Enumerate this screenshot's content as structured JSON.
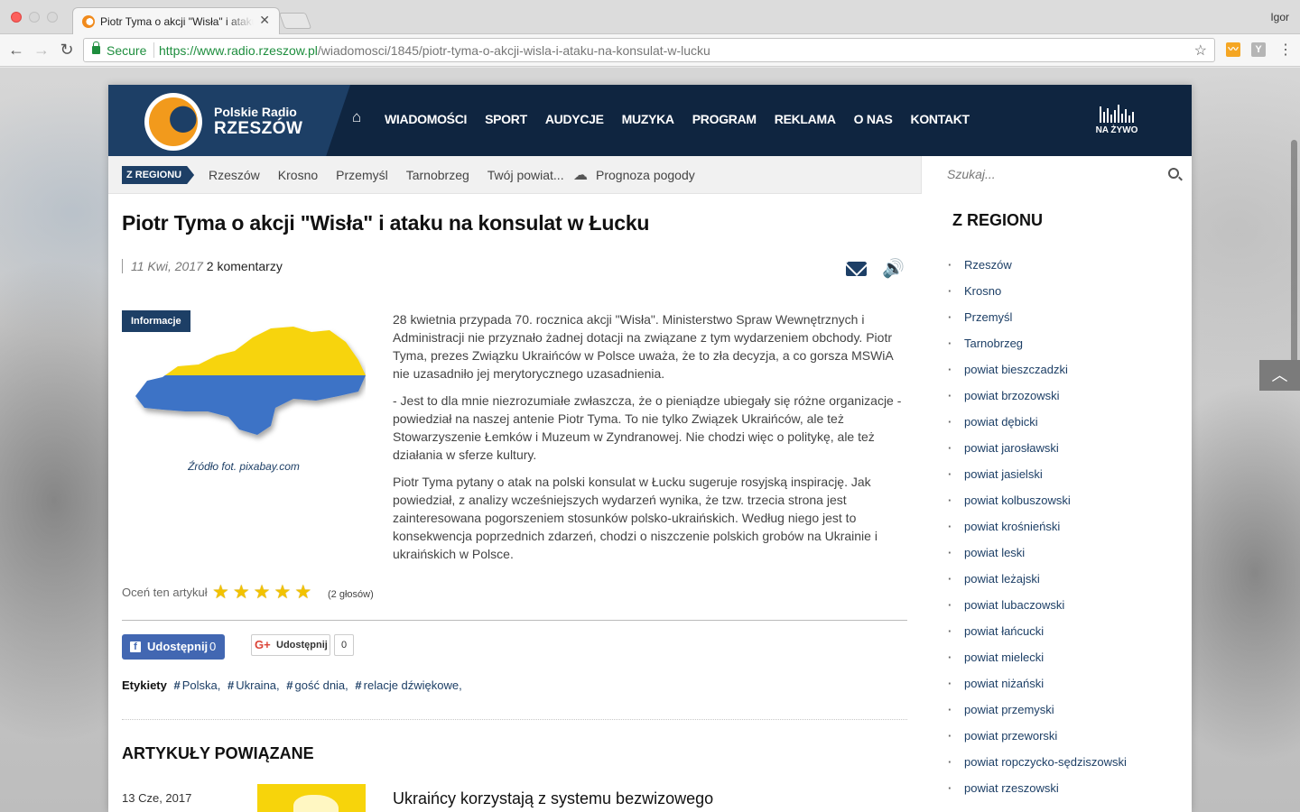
{
  "browser": {
    "tab_title": "Piotr Tyma o akcji \"Wisła\" i ataku na konsulat w Łucku",
    "tab_close": "✕",
    "user": "Igor",
    "secure_label": "Secure",
    "url_scheme_host": "https://www.radio.rzeszow.pl",
    "url_path": "/wiadomosci/1845/piotr-tyma-o-akcji-wisla-i-ataku-na-konsulat-w-lucku",
    "ext_y_letter": "Y"
  },
  "header": {
    "logo_line1": "Polskie Radio",
    "logo_line2": "RZESZÓW",
    "nav": [
      "WIADOMOŚCI",
      "SPORT",
      "AUDYCJE",
      "MUZYKA",
      "PROGRAM",
      "REKLAMA",
      "O NAS",
      "KONTAKT"
    ],
    "live_label": "NA ŻYWO"
  },
  "subnav": {
    "badge": "Z REGIONU",
    "links": [
      "Rzeszów",
      "Krosno",
      "Przemyśl",
      "Tarnobrzeg",
      "Twój powiat..."
    ],
    "weather": "Prognoza pogody",
    "search_placeholder": "Szukaj..."
  },
  "article": {
    "title": "Piotr Tyma o akcji \"Wisła\" i ataku na konsulat w Łucku",
    "date": "11 Kwi, 2017",
    "comments": "2 komentarzy",
    "category_badge": "Informacje",
    "image_caption": "Źródło fot. pixabay.com",
    "paragraphs": [
      "28 kwietnia przypada 70. rocznica akcji \"Wisła\". Ministerstwo Spraw Wewnętrznych i Administracji nie przyznało żadnej dotacji na związane z tym wydarzeniem obchody. Piotr Tyma, prezes Związku Ukraińców w Polsce uważa, że to zła decyzja, a co gorsza MSWiA nie uzasadniło jej merytorycznego uzasadnienia.",
      "- Jest to dla mnie niezrozumiałe zwłaszcza, że o pieniądze ubiegały się różne organizacje - powiedział na naszej antenie Piotr Tyma. To nie tylko Związek Ukraińców, ale też Stowarzyszenie Łemków i Muzeum w Zyndranowej. Nie chodzi więc o politykę, ale też działania w sferze kultury.",
      "Piotr Tyma pytany o atak na polski konsulat w Łucku sugeruje rosyjską inspirację. Jak powiedział, z analizy wcześniejszych wydarzeń wynika, że tzw. trzecia strona jest zainteresowana pogorszeniem stosunków polsko-ukraińskich. Według niego jest to konsekwencja poprzednich zdarzeń, chodzi o niszczenie polskich grobów na Ukrainie i ukraińskich w Polsce."
    ],
    "rating_label": "Oceń ten artykuł",
    "rating_stars": 5,
    "rating_max": 5,
    "votes": "(2 głosów)",
    "fb_share_label": "Udostępnij",
    "fb_share_count": "0",
    "gplus_label": "Udostępnij",
    "gplus_count": "0",
    "tags_label": "Etykiety",
    "tags": [
      "Polska,",
      "Ukraina,",
      "gość dnia,",
      "relacje dźwiękowe,"
    ]
  },
  "related": {
    "title": "ARTYKUŁY POWIĄZANE",
    "items": [
      {
        "date": "13 Cze, 2017",
        "title": "Ukraińcy korzystają z systemu bezwizowego"
      }
    ]
  },
  "sidebar": {
    "title": "Z REGIONU",
    "items": [
      "Rzeszów",
      "Krosno",
      "Przemyśl",
      "Tarnobrzeg",
      "powiat bieszczadzki",
      "powiat brzozowski",
      "powiat dębicki",
      "powiat jarosławski",
      "powiat jasielski",
      "powiat kolbuszowski",
      "powiat krośnieński",
      "powiat leski",
      "powiat leżajski",
      "powiat lubaczowski",
      "powiat łańcucki",
      "powiat mielecki",
      "powiat niżański",
      "powiat przemyski",
      "powiat przeworski",
      "powiat ropczycko-sędziszowski",
      "powiat rzeszowski"
    ]
  },
  "colors": {
    "brand_navy": "#0f2540",
    "brand_blue": "#1d3f66",
    "brand_orange": "#f29a1c",
    "facebook": "#4267b2",
    "star": "#f2c200",
    "ukraine_yellow": "#f7d40b",
    "ukraine_blue": "#3d73c6"
  },
  "icons": [
    "home-icon",
    "cloud-icon",
    "search-icon",
    "mail-icon",
    "speaker-icon",
    "star-icon",
    "chevron-up-icon",
    "facebook-icon",
    "google-plus-icon",
    "hash-icon"
  ]
}
